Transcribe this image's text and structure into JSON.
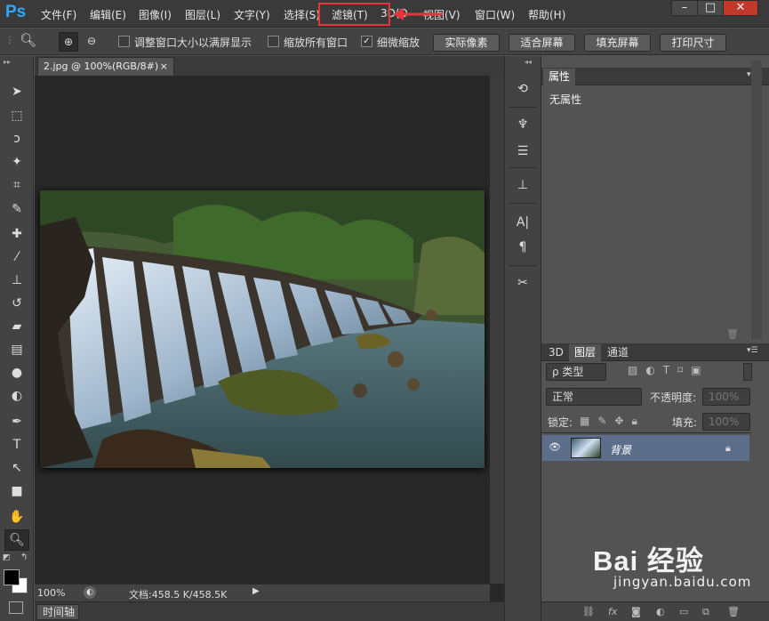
{
  "app": {
    "logo": "Ps"
  },
  "menubar": {
    "items": [
      "文件(F)",
      "编辑(E)",
      "图像(I)",
      "图层(L)",
      "文字(Y)",
      "选择(S)",
      "滤镜(T)",
      "3D(D)",
      "视图(V)",
      "窗口(W)",
      "帮助(H)"
    ],
    "highlight_color": "#e8333a",
    "window_buttons": [
      "minimize-icon",
      "maximize-icon",
      "close-icon"
    ]
  },
  "options": {
    "cb1_label": "调整窗口大小以满屏显示",
    "cb2_label": "缩放所有窗口",
    "cb3_label": "细微缩放",
    "cb3_checked": "✓",
    "btn_actual": "实际像素",
    "btn_fit": "适合屏幕",
    "btn_fill": "填充屏幕",
    "btn_print": "打印尺寸"
  },
  "document": {
    "tab_title": "2.jpg @ 100%(RGB/8#)",
    "close": "×"
  },
  "status": {
    "zoom": "100%",
    "doc_size": "文档:458.5 K/458.5K"
  },
  "timeline": {
    "label": "时间轴"
  },
  "properties": {
    "tab": "属性",
    "content": "无属性"
  },
  "layers": {
    "tabs": [
      "3D",
      "图层",
      "通道"
    ],
    "filter_kind": "ρ 类型",
    "blend_mode": "正常",
    "opacity_label": "不透明度:",
    "opacity_value": "100%",
    "lock_label": "锁定:",
    "fill_label": "填充:",
    "fill_value": "100%",
    "layer_name": "背景"
  },
  "watermark": {
    "brand": "Bai 经验",
    "url": "jingyan.baidu.com"
  }
}
